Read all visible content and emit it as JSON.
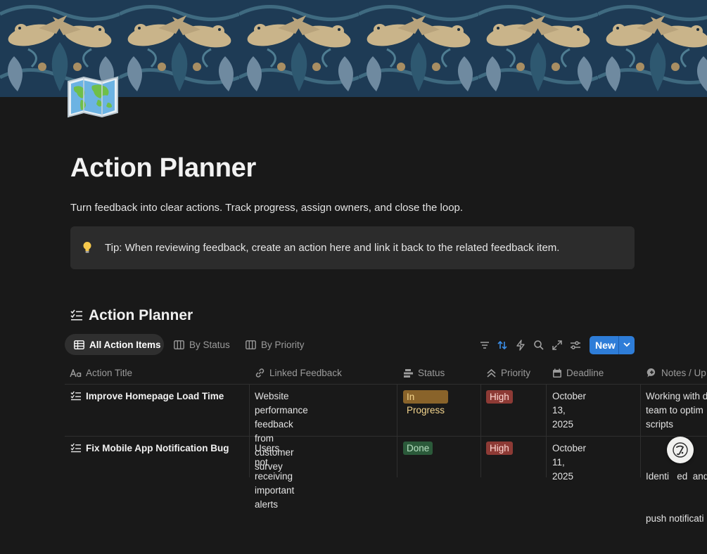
{
  "page": {
    "title": "Action Planner",
    "description": "Turn feedback into clear actions. Track progress, assign owners, and close the loop.",
    "icon": "world-map-icon",
    "cover": "bird-tapestry-pattern"
  },
  "callout": {
    "icon": "lightbulb-icon",
    "text": "Tip: When reviewing feedback, create an action here and link it back to the related feedback item."
  },
  "database": {
    "title": "Action Planner",
    "icon": "checklist-icon",
    "views": [
      {
        "label": "All Action Items",
        "icon": "table-icon",
        "active": true
      },
      {
        "label": "By Status",
        "icon": "board-icon",
        "active": false
      },
      {
        "label": "By Priority",
        "icon": "board-icon",
        "active": false
      }
    ],
    "toolbar": {
      "tools": [
        "filter-icon",
        "sort-icon",
        "automation-icon",
        "search-icon",
        "expand-icon",
        "settings-icon"
      ],
      "new_label": "New"
    },
    "columns": [
      {
        "label": "Action Title",
        "icon": "text-type-icon"
      },
      {
        "label": "Linked Feedback",
        "icon": "relation-link-icon"
      },
      {
        "label": "Status",
        "icon": "status-icon"
      },
      {
        "label": "Priority",
        "icon": "priority-chevrons-icon"
      },
      {
        "label": "Deadline",
        "icon": "calendar-icon"
      },
      {
        "label": "Notes / Up",
        "icon": "comment-icon"
      }
    ],
    "rows": [
      {
        "title": "Improve Homepage Load Time",
        "feedback_1": "Website performance feedback",
        "feedback_2": "from customer survey",
        "status": "In Progress",
        "priority": "High",
        "deadline": "October 13, 2025",
        "notes_1": "Working with d",
        "notes_2": "team to optim",
        "notes_3": "scripts"
      },
      {
        "title": "Fix Mobile App Notification Bug",
        "feedback_1": "Users not receiving important",
        "feedback_2": "alerts",
        "status": "Done",
        "priority": "High",
        "deadline": "October 11, 2025",
        "notes_1": "Identi   ed  and",
        "notes_2": "push notificati",
        "notes_3": ""
      }
    ]
  },
  "colors": {
    "background": "#191919",
    "callout_bg": "#2c2c2c",
    "accent_blue": "#2e7dd8",
    "status_in_progress_bg": "#89632a",
    "status_in_progress_fg": "#f4d58d",
    "status_done_bg": "#2b5a3a",
    "status_done_fg": "#b8e0c2",
    "priority_high_bg": "#8d3a35",
    "priority_high_fg": "#ffd9d4"
  },
  "help": {
    "icon": "help-assistant-icon"
  }
}
